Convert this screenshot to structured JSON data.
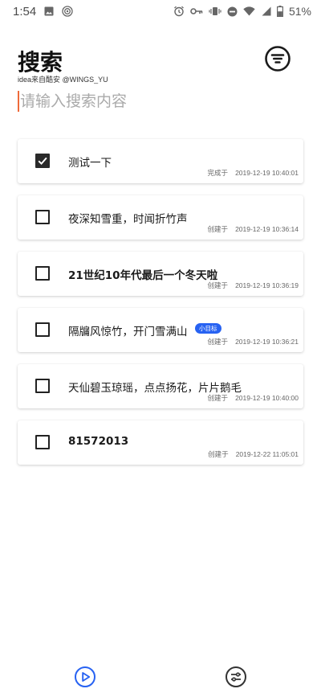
{
  "status_bar": {
    "time": "1:54",
    "battery": "51%",
    "icons": [
      "image-icon",
      "podcast-icon",
      "alarm-icon",
      "key-icon",
      "vibrate-icon",
      "do-not-disturb-icon",
      "wifi-icon",
      "signal-icon",
      "battery-icon"
    ]
  },
  "header": {
    "title": "搜索",
    "subtitle": "idea来自酷安 @WINGS_YU",
    "filter_icon": "filter-icon"
  },
  "search": {
    "placeholder": "请输入搜索内容",
    "value": ""
  },
  "items": [
    {
      "title": "测试一下",
      "checked": true,
      "status": "完成于",
      "time": "2019-12-19 10:40:01"
    },
    {
      "title": "夜深知雪重，时闻折竹声",
      "checked": false,
      "status": "创建于",
      "time": "2019-12-19 10:36:14"
    },
    {
      "title": "21世纪10年代最后一个冬天啦",
      "checked": false,
      "status": "创建于",
      "time": "2019-12-19 10:36:19"
    },
    {
      "title": "隔牖风惊竹，开门雪满山",
      "checked": false,
      "status": "创建于",
      "time": "2019-12-19 10:36:21",
      "tag": "小目标"
    },
    {
      "title": "天仙碧玉琼瑶，点点扬花，片片鹅毛",
      "checked": false,
      "status": "创建于",
      "time": "2019-12-19 10:40:00"
    },
    {
      "title": "81572013",
      "checked": false,
      "status": "创建于",
      "time": "2019-12-22 11:05:01"
    }
  ],
  "colors": {
    "accent": "#2762f2",
    "cursor": "#ef6a3a",
    "checked_box": "#2a2a2a"
  },
  "bottom_nav": {
    "left_icon": "play-circle-icon",
    "right_icon": "settings-sliders-icon"
  }
}
